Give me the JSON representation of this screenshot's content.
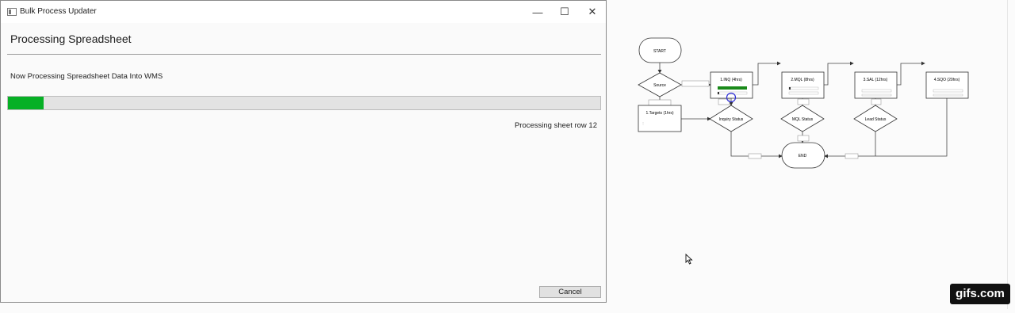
{
  "window": {
    "title": "Bulk Process Updater",
    "controls": {
      "minimize": "—",
      "maximize": "☐",
      "close": "✕"
    },
    "heading": "Processing Spreadsheet",
    "message": "Now Processing Spreadsheet Data Into WMS",
    "progress_percent": 6,
    "progress_color": "#06b025",
    "status": "Processing sheet row 12",
    "cancel_label": "Cancel"
  },
  "flowchart": {
    "start": "START",
    "source": "Source",
    "targets": "1.Targets (1hrs)",
    "stages": [
      "1.INQ (4hrs)",
      "2.MQL (8hrs)",
      "3.SAL (12hrs)",
      "4.SQO (20hrs)"
    ],
    "decisions": [
      "Inquiry Status",
      "MQL Status",
      "Lead Status"
    ],
    "end": "END",
    "inq_progress_color": "#1a8a1a",
    "highlight_color": "#2b2bd6"
  },
  "watermark": "gifs.com"
}
